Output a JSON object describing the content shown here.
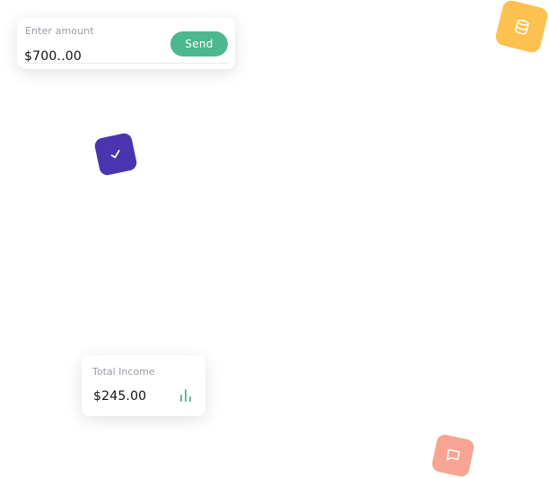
{
  "amount_card": {
    "label": "Enter amount",
    "value": "$700..00",
    "send_label": "Send"
  },
  "income_card": {
    "label": "Total Income",
    "value": "$245.00"
  },
  "tiles": {
    "check": {
      "icon": "check-icon",
      "color": "#4a34b0"
    },
    "database": {
      "icon": "database-icon",
      "color": "#fcc14f"
    },
    "message": {
      "icon": "message-icon",
      "color": "#f7a592"
    }
  },
  "colors": {
    "accent_green": "#4db88f"
  }
}
